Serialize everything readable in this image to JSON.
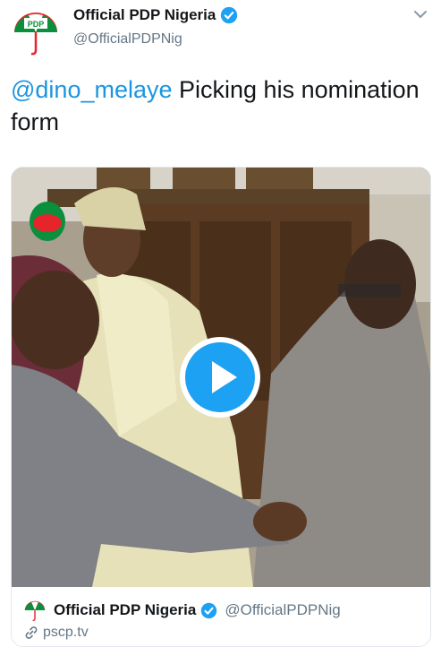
{
  "tweet": {
    "author": {
      "display_name": "Official PDP Nigeria",
      "handle": "@OfficialPDPNig",
      "avatar_icon": "pdp-umbrella-logo",
      "logo_text": "PDP",
      "verified_icon": "verified-badge-icon"
    },
    "menu_icon": "chevron-down-icon",
    "text": {
      "mention": "@dino_melaye",
      "body": " Picking his nomination form"
    },
    "media": {
      "type": "video",
      "play_icon": "play-icon"
    },
    "card": {
      "author_name": "Official PDP Nigeria",
      "author_handle": "@OfficialPDPNig",
      "link_icon": "link-icon",
      "link_text": "pscp.tv"
    }
  },
  "colors": {
    "link": "#1b95e0",
    "verified": "#1da1f2",
    "secondary_text": "#657786",
    "pdp_green": "#0a8f3c",
    "pdp_red": "#e5242c"
  }
}
